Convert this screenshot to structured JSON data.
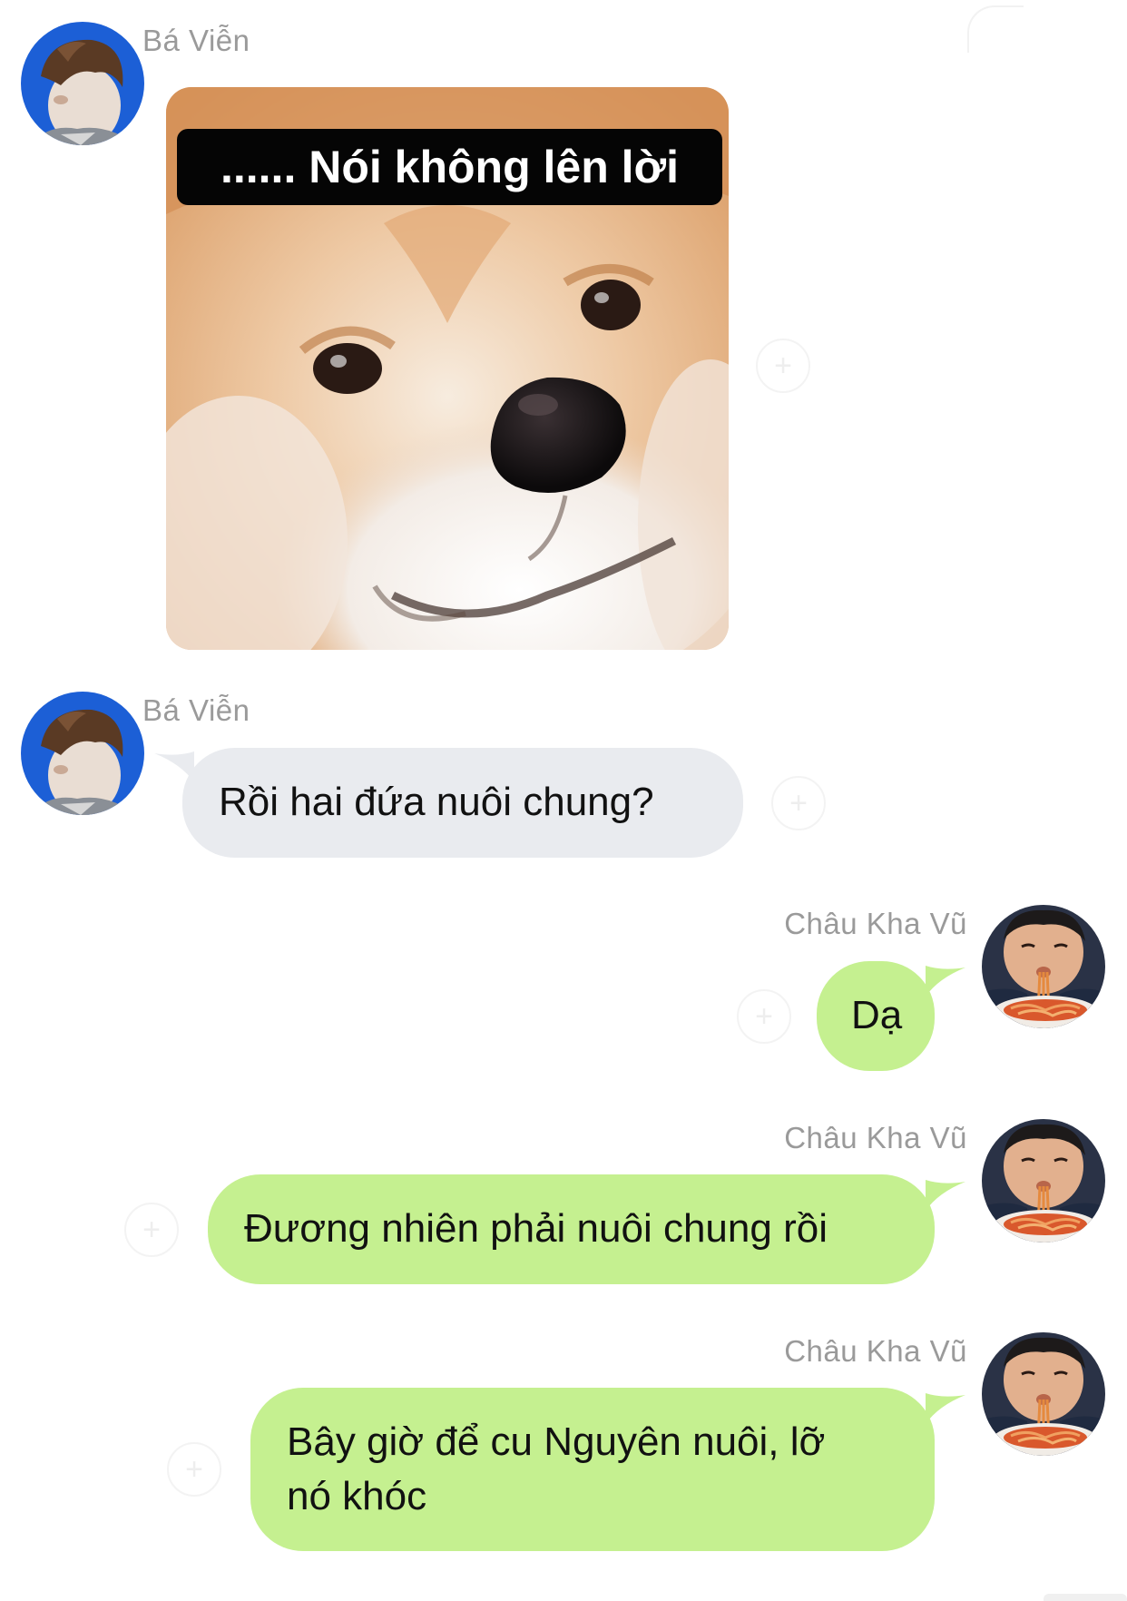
{
  "messages": [
    {
      "sender": "Bá Viễn",
      "type": "sticker",
      "caption": "...... Nói không lên lời"
    },
    {
      "sender": "Bá Viễn",
      "type": "text",
      "text": "Rồi hai đứa nuôi chung?"
    },
    {
      "sender": "Châu Kha Vũ",
      "type": "text",
      "text": "Dạ"
    },
    {
      "sender": "Châu Kha Vũ",
      "type": "text",
      "text": "Đương nhiên phải nuôi chung rồi"
    },
    {
      "sender": "Châu Kha Vũ",
      "type": "text",
      "text_line1": "Bây giờ để cu Nguyên nuôi, lỡ",
      "text_line2": "nó khóc"
    }
  ],
  "colors": {
    "incoming_bubble": "#e9ebef",
    "outgoing_bubble": "#c5f090",
    "sender_name": "#9a9a9a",
    "avatar_left_bg": "#1c5fd6"
  },
  "icons": {
    "react": "add-reaction-icon",
    "avatar_left": "person-profile-avatar",
    "avatar_right": "child-eating-noodles-avatar"
  }
}
